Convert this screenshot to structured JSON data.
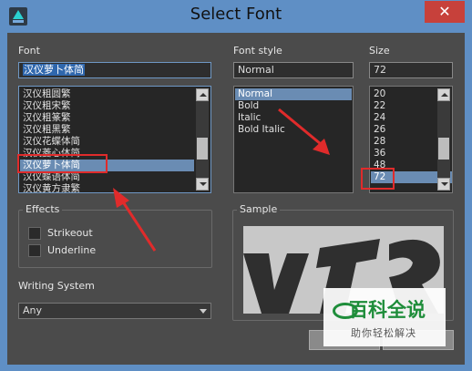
{
  "window": {
    "title": "Select Font",
    "close_glyph": "✕",
    "icon": "app-icon"
  },
  "font": {
    "label": "Font",
    "current": "汉仪萝卜体简",
    "items": [
      "汉仪粗圆繁",
      "汉仪粗宋繁",
      "汉仪粗篆繁",
      "汉仪粗黑繁",
      "汉仪花蝶体简",
      "汉仪菱心体简",
      "汉仪萝卜体简",
      "汉仪蝶语体简",
      "汉仪黄方隶繁"
    ]
  },
  "font_style": {
    "label": "Font style",
    "current": "Normal",
    "items": [
      "Normal",
      "Bold",
      "Italic",
      "Bold Italic"
    ]
  },
  "size": {
    "label": "Size",
    "current": "72",
    "items": [
      "20",
      "22",
      "24",
      "26",
      "28",
      "36",
      "48",
      "72"
    ]
  },
  "effects": {
    "label": "Effects",
    "strikeout": "Strikeout",
    "underline": "Underline",
    "strikeout_checked": false,
    "underline_checked": false
  },
  "writing_system": {
    "label": "Writing System",
    "value": "Any"
  },
  "sample": {
    "label": "Sample"
  },
  "watermark": {
    "title": "百科全说",
    "subtitle": "助你轻松解决"
  },
  "colors": {
    "titlebar": "#5f8fc5",
    "dialog_bg": "#4b4b4b",
    "selection": "#6a8cb3",
    "annotation": "#e02b2b",
    "watermark_green": "#1e8d3a"
  }
}
